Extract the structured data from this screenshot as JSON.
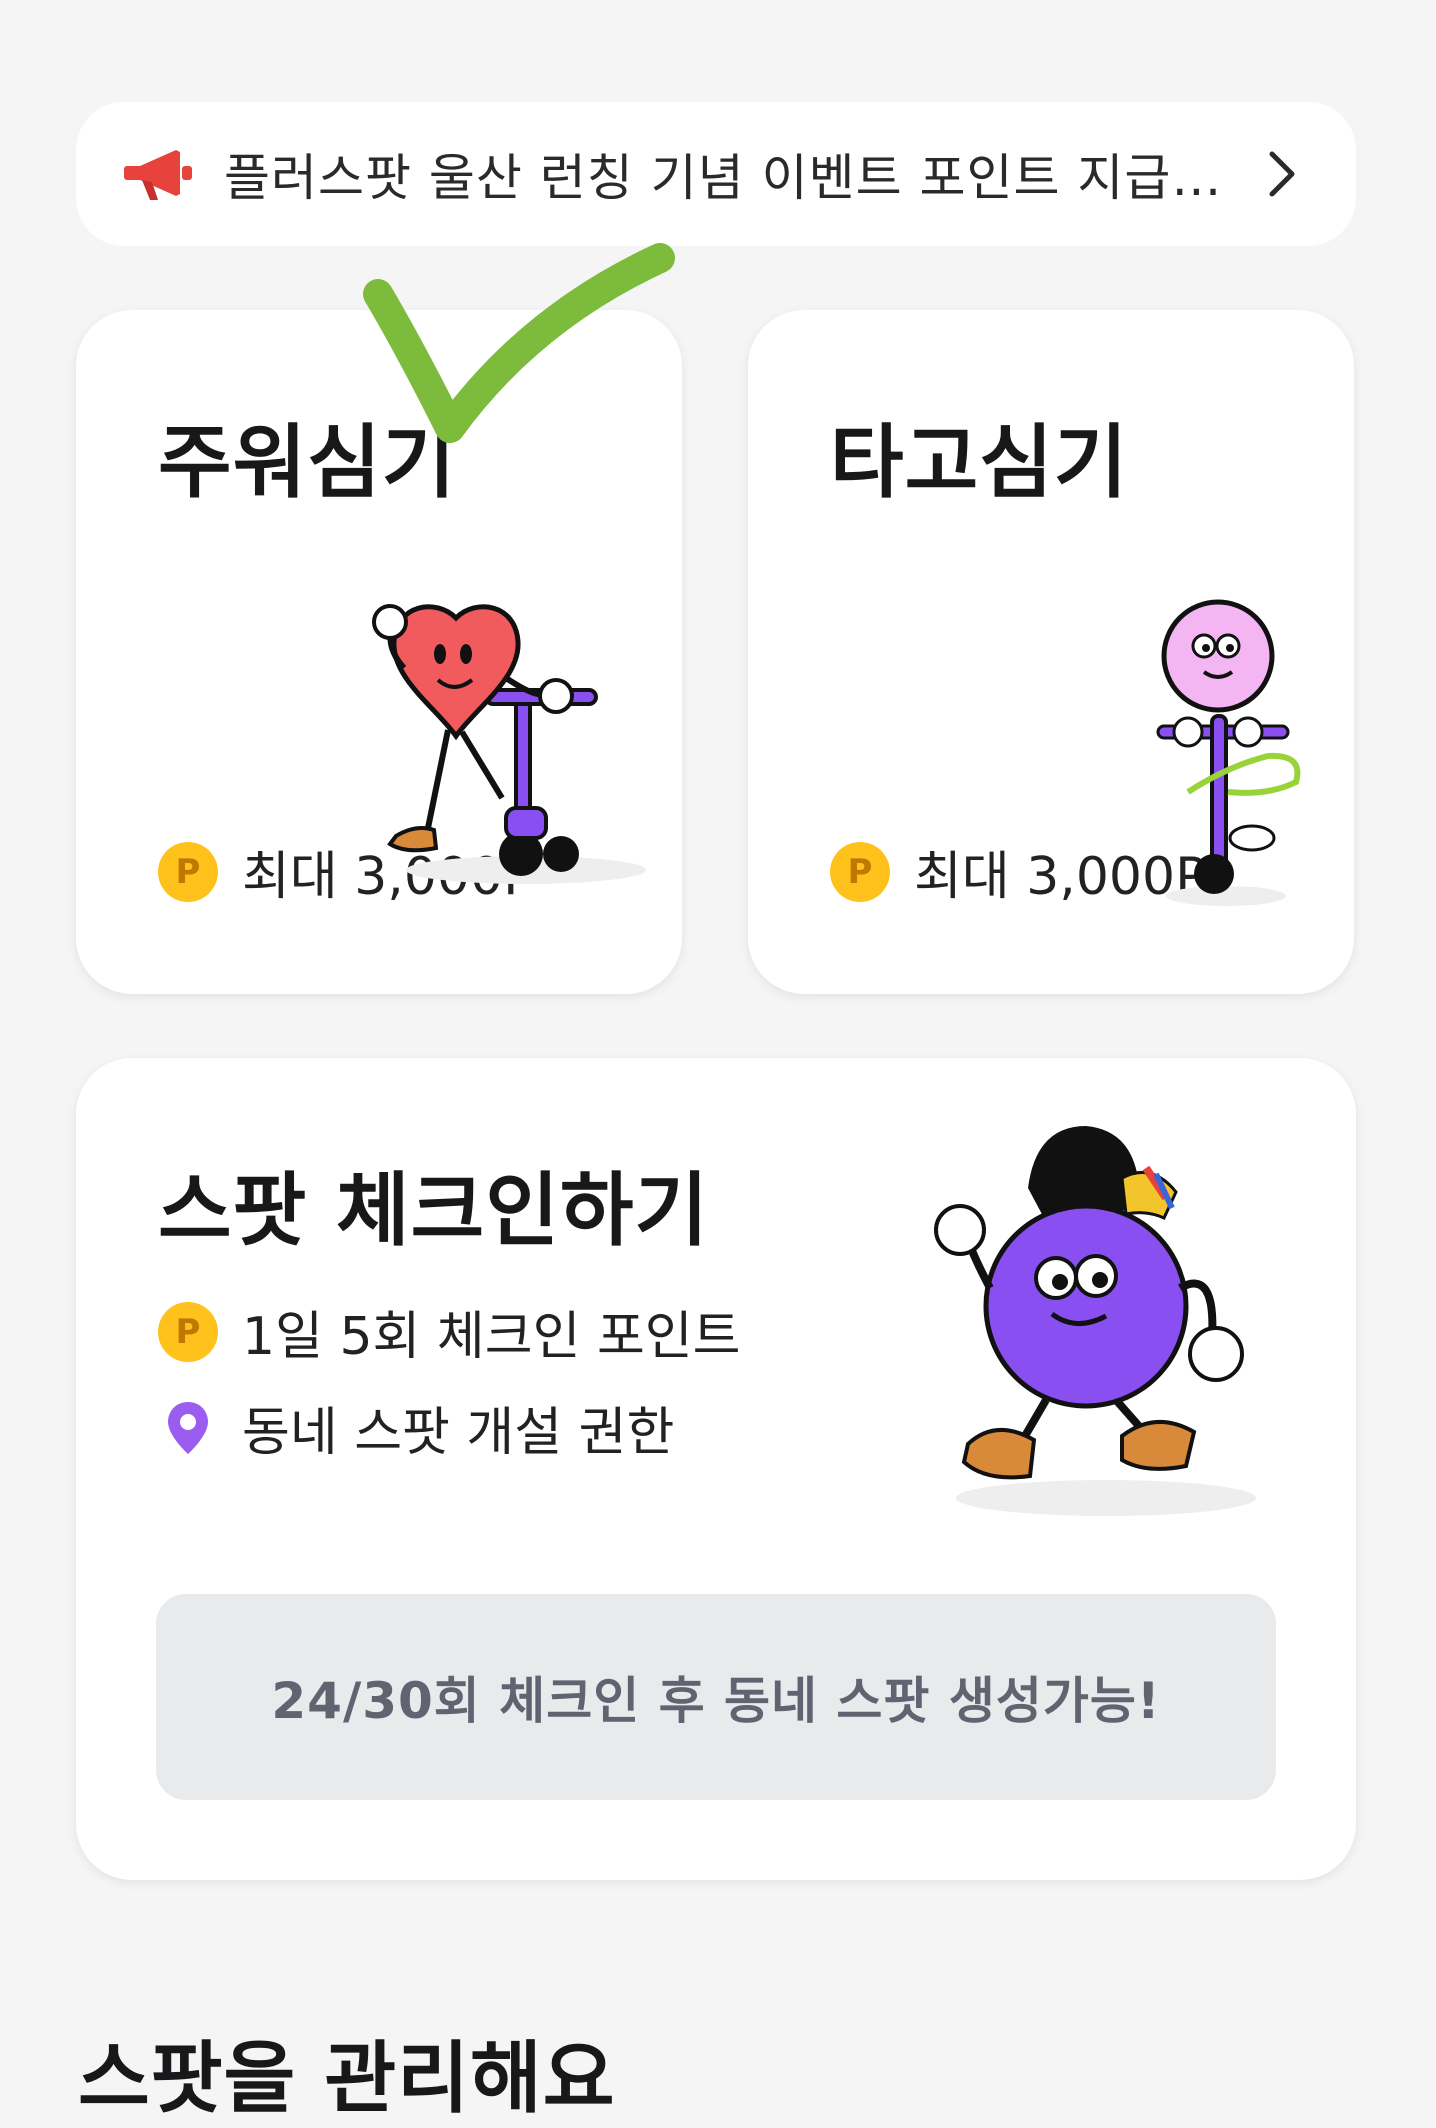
{
  "notice": {
    "text": "플러스팟 울산 런칭 기념 이벤트 포인트 지급 안내",
    "icon": "megaphone-icon",
    "chevron_icon": "chevron-right-icon"
  },
  "cards": {
    "pickup": {
      "title": "주워심기",
      "reward": "최대 3,000P",
      "coin_label": "P"
    },
    "ride": {
      "title": "타고심기",
      "reward": "최대 3,000P",
      "coin_label": "P"
    },
    "spot": {
      "title": "스팟 체크인하기",
      "row1": "1일 5회 체크인 포인트",
      "row2": "동네 스팟 개설 권한",
      "coin_label": "P",
      "button": "24/30회 체크인 후 동네 스팟 생성가능!"
    }
  },
  "section": {
    "title": "스팟을 관리해요"
  },
  "colors": {
    "background": "#f5f5f6",
    "coin": "#ffc21c",
    "pin": "#9b5cf0",
    "megaphone": "#e8423c",
    "checkmark": "#7dbb3c",
    "button_bg": "#e9eaec",
    "button_text": "#5f6470"
  }
}
